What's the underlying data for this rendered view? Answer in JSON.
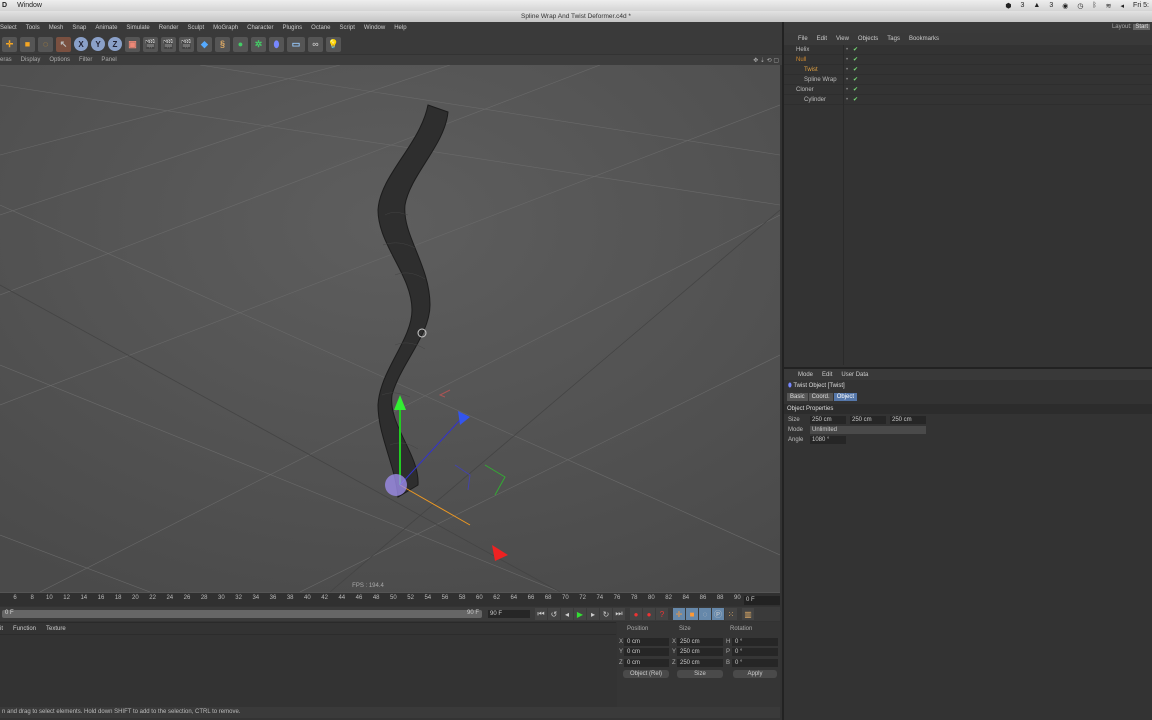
{
  "mac_menu": {
    "app": "D",
    "items": [
      "Window"
    ],
    "clock": "Fri 5:",
    "badges": [
      "3",
      "3"
    ]
  },
  "window_title": "Spline Wrap And Twist Deformer.c4d *",
  "menu": [
    "Select",
    "Tools",
    "Mesh",
    "Snap",
    "Animate",
    "Simulate",
    "Render",
    "Sculpt",
    "MoGraph",
    "Character",
    "Plugins",
    "Octane",
    "Script",
    "Window",
    "Help"
  ],
  "toolbar": {
    "axes": [
      "X",
      "Y",
      "Z"
    ]
  },
  "viewport_menu": [
    "eras",
    "Display",
    "Options",
    "Filter",
    "Panel"
  ],
  "fps": "FPS : 194.4",
  "timeline": {
    "ticks": [
      "6",
      "8",
      "10",
      "12",
      "14",
      "16",
      "18",
      "20",
      "22",
      "24",
      "26",
      "28",
      "30",
      "32",
      "34",
      "36",
      "38",
      "40",
      "42",
      "44",
      "46",
      "48",
      "50",
      "52",
      "54",
      "56",
      "58",
      "60",
      "62",
      "64",
      "66",
      "68",
      "70",
      "72",
      "74",
      "76",
      "78",
      "80",
      "82",
      "84",
      "86",
      "88",
      "90"
    ],
    "current_frame": "0 F",
    "start": "0 F",
    "end_small": "90 F",
    "end": "90 F"
  },
  "materials_menu": [
    "it",
    "Function",
    "Texture"
  ],
  "coords": {
    "headers": [
      "Position",
      "Size",
      "Rotation"
    ],
    "rows": [
      {
        "a": "X",
        "p": "0 cm",
        "b": "X",
        "s": "250 cm",
        "c": "H",
        "r": "0 °"
      },
      {
        "a": "Y",
        "p": "0 cm",
        "b": "Y",
        "s": "250 cm",
        "c": "P",
        "r": "0 °"
      },
      {
        "a": "Z",
        "p": "0 cm",
        "b": "Z",
        "s": "250 cm",
        "c": "B",
        "r": "0 °"
      }
    ],
    "mode": "Object (Rel)",
    "size_mode": "Size",
    "apply": "Apply"
  },
  "status": "n and drag to select elements. Hold down SHIFT to add to the selection, CTRL to remove.",
  "layout": {
    "label": "Layout:",
    "value": "Start"
  },
  "object_manager": {
    "menu": [
      "File",
      "Edit",
      "View",
      "Objects",
      "Tags",
      "Bookmarks"
    ],
    "objects": [
      {
        "name": "Helix",
        "depth": 0,
        "color": "#bbbbbb"
      },
      {
        "name": "Null",
        "depth": 0,
        "color": "#d08a30"
      },
      {
        "name": "Twist",
        "depth": 1,
        "color": "#e0a040"
      },
      {
        "name": "Spline Wrap",
        "depth": 1,
        "color": "#bbbbbb"
      },
      {
        "name": "Cloner",
        "depth": 0,
        "color": "#bbbbbb"
      },
      {
        "name": "Cylinder",
        "depth": 1,
        "color": "#bbbbbb"
      }
    ]
  },
  "attribute_manager": {
    "menu": [
      "Mode",
      "Edit",
      "User Data"
    ],
    "title": "Twist Object [Twist]",
    "tabs": [
      "Basic",
      "Coord.",
      "Object"
    ],
    "section": "Object Properties",
    "size_label": "Size",
    "size": [
      "250 cm",
      "250 cm",
      "250 cm"
    ],
    "mode_label": "Mode",
    "mode": "Unlimited",
    "angle_label": "Angle",
    "angle": "1080 °"
  }
}
